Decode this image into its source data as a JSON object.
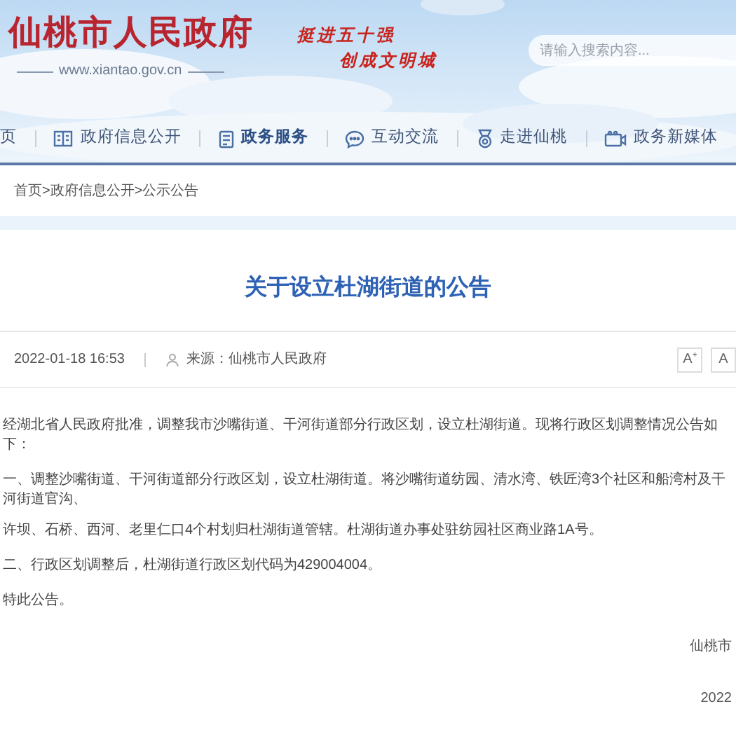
{
  "header": {
    "site_title": "仙桃市人民政府",
    "site_url": "www.xiantao.gov.cn",
    "slogan": [
      "挺进五十强",
      "创成文明城"
    ],
    "search": {
      "placeholder": "请输入搜索内容..."
    }
  },
  "nav": [
    {
      "label": "页",
      "selected": false
    },
    {
      "label": "政府信息公开",
      "selected": false
    },
    {
      "label": "政务服务",
      "selected": true
    },
    {
      "label": "互动交流",
      "selected": false
    },
    {
      "label": "走进仙桃",
      "selected": false
    },
    {
      "label": "政务新媒体",
      "selected": false
    }
  ],
  "breadcrumb": "首页>政府信息公开>公示公告",
  "article": {
    "title": "关于设立杜湖街道的公告",
    "published": "2022-01-18 16:53",
    "source": "来源：仙桃市人民政府",
    "font_buttons": [
      "A⁺",
      "A"
    ],
    "paragraphs": [
      [
        "经湖北省人民政府批准，调整我市沙嘴街道、干河街道部分行政区划，设立杜湖街道。现将行政区划调整情况公告如下："
      ],
      [
        "一、调整沙嘴街道、干河街道部分行政区划，设立杜湖街道。将沙嘴街道纺园、清水湾、铁匠湾3个社区和船湾村及干河街道官沟、",
        "许坝、石桥、西河、老里仁口4个村划归杜湖街道管辖。杜湖街道办事处驻纺园社区商业路1A号。"
      ],
      [
        "二、行政区划调整后，杜湖街道行政区划代码为429004004。"
      ],
      [
        "特此公告。"
      ]
    ],
    "signature": "仙桃市",
    "date": "2022"
  }
}
